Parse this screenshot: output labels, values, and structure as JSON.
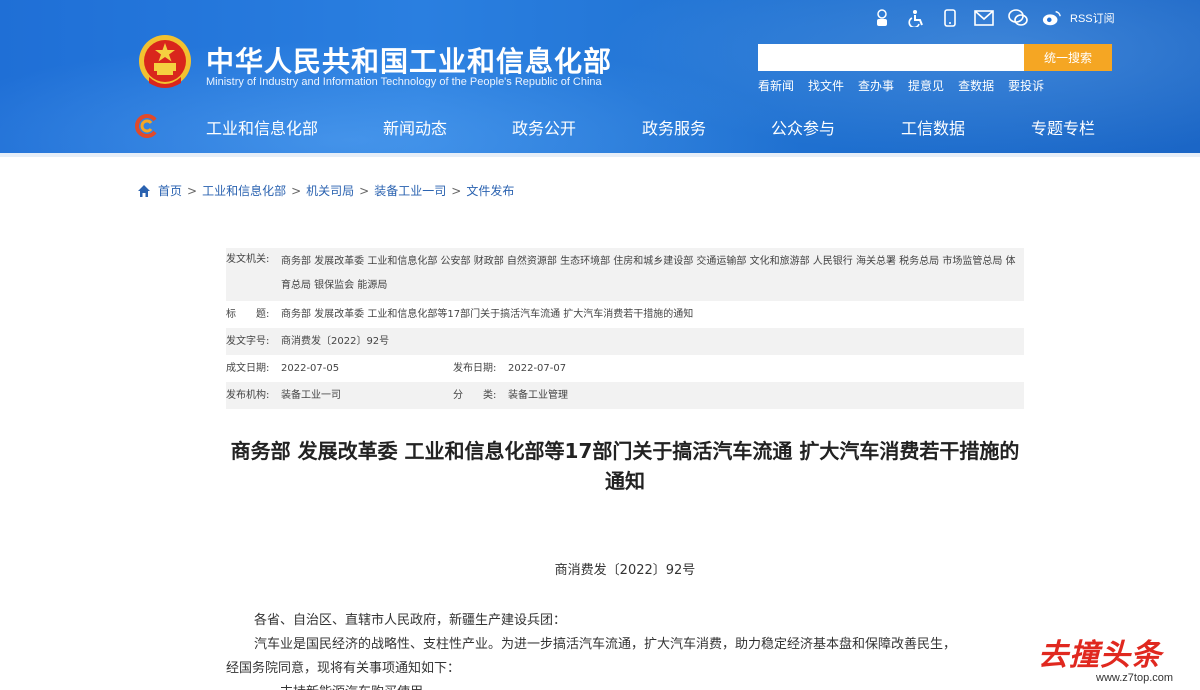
{
  "site": {
    "title": "中华人民共和国工业和信息化部",
    "subtitle": "Ministry of Industry and Information Technology of the People's Republic of China"
  },
  "top_icons": [
    "robot-icon",
    "accessibility-icon",
    "mobile-icon",
    "mail-icon",
    "wechat-icon",
    "weibo-icon"
  ],
  "rss_label": "RSS订阅",
  "search": {
    "placeholder": "",
    "button_label": "统一搜索"
  },
  "quick_links": [
    "看新闻",
    "找文件",
    "查办事",
    "提意见",
    "查数据",
    "要投诉"
  ],
  "nav": [
    "工业和信息化部",
    "新闻动态",
    "政务公开",
    "政务服务",
    "公众参与",
    "工信数据",
    "专题专栏"
  ],
  "breadcrumb": [
    "首页",
    "工业和信息化部",
    "机关司局",
    "装备工业一司",
    "文件发布"
  ],
  "meta": {
    "authorities_label": "发文机关:",
    "authorities_value": "商务部 发展改革委 工业和信息化部 公安部 财政部 自然资源部 生态环境部 住房和城乡建设部 交通运输部 文化和旅游部 人民银行 海关总署 税务总局 市场监管总局 体育总局 银保监会 能源局",
    "title_label": "标　　题:",
    "title_value": "商务部 发展改革委 工业和信息化部等17部门关于搞活汽车流通 扩大汽车消费若干措施的通知",
    "doc_no_label": "发文字号:",
    "doc_no_value": "商消费发〔2022〕92号",
    "created_label": "成文日期:",
    "created_value": "2022-07-05",
    "published_label": "发布日期:",
    "published_value": "2022-07-07",
    "org_label": "发布机构:",
    "org_value": "装备工业一司",
    "category_label": "分　　类:",
    "category_value": "装备工业管理"
  },
  "article": {
    "title": "商务部 发展改革委 工业和信息化部等17部门关于搞活汽车流通 扩大汽车消费若干措施的通知",
    "doc_number": "商消费发〔2022〕92号",
    "paragraphs": [
      "各省、自治区、直辖市人民政府，新疆生产建设兵团：",
      "汽车业是国民经济的战略性、支柱性产业。为进一步搞活汽车流通，扩大汽车消费，助力稳定经济基本盘和保障改善民生，",
      "经国务院同意，现将有关事项通知如下：",
      "一、支持新能源汽车购买使用"
    ]
  },
  "watermark": {
    "text": "去撞头条",
    "url": "www.z7top.com"
  },
  "colors": {
    "header_blue": "#1f6fd6",
    "search_orange": "#f5a623",
    "link_blue": "#2a62b0",
    "watermark_red": "#e0281f"
  }
}
